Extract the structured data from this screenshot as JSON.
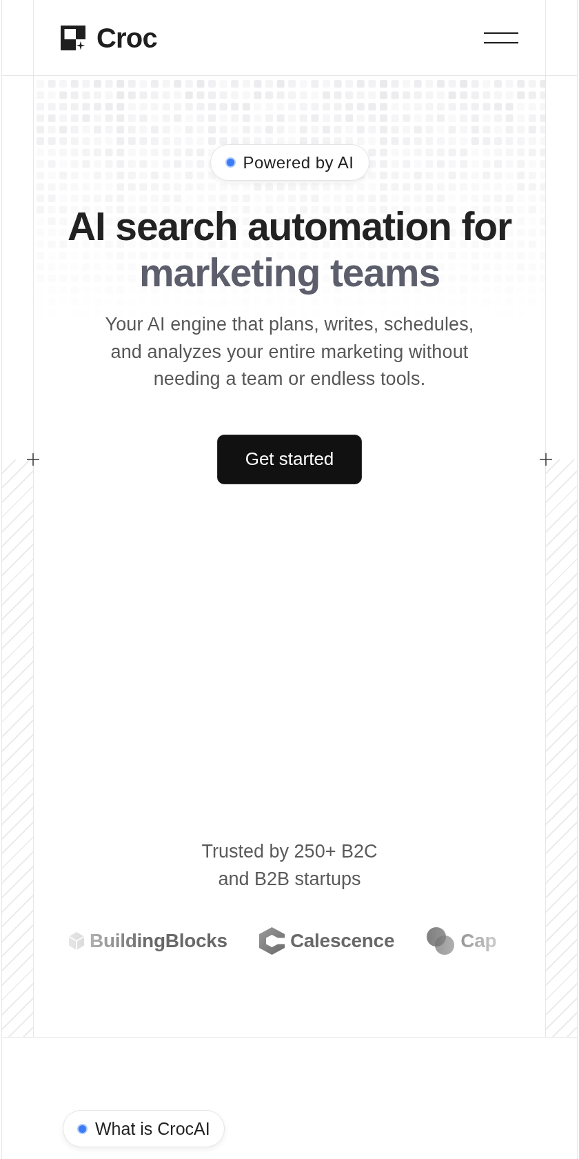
{
  "header": {
    "brand": "Croc"
  },
  "hero": {
    "badge": "Powered by AI",
    "title": "AI search automation for",
    "title_highlight": "marketing teams",
    "subtitle": "Your AI engine that plans, writes, schedules, and analyzes your entire marketing without needing a team or endless tools.",
    "button": "Get started"
  },
  "trusted": {
    "text": "Trusted by 250+ B2C and B2B startups",
    "logos": [
      {
        "kind": "blocks",
        "name": "BuildingBlocks"
      },
      {
        "kind": "hexagon",
        "name": "Calescence"
      },
      {
        "kind": "circles",
        "name": "Cap"
      }
    ]
  },
  "next_section": {
    "badge": "What is CrocAI"
  }
}
